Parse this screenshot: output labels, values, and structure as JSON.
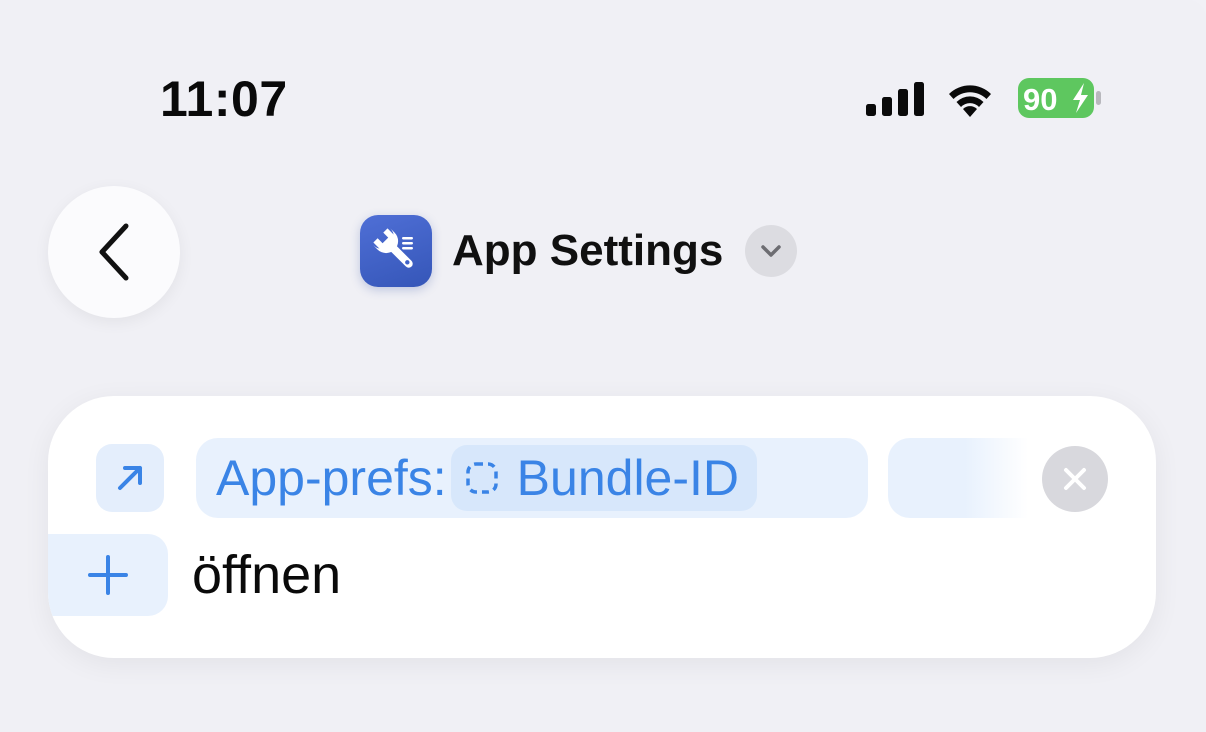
{
  "status_bar": {
    "time": "11:07",
    "battery_level": "90",
    "icons": [
      "cellular-signal-icon",
      "wifi-icon",
      "battery-charging-icon"
    ]
  },
  "header": {
    "back_icon": "chevron-left-icon",
    "app_icon": "wrench-icon",
    "title": "App Settings",
    "menu_icon": "chevron-down-icon"
  },
  "action": {
    "icon": "arrow-up-right-icon",
    "url_prefix": "App-prefs:",
    "variable_icon": "dashed-square-icon",
    "variable_label": "Bundle-ID",
    "clear_icon": "close-icon",
    "add_icon": "plus-icon",
    "verb": "öffnen"
  },
  "colors": {
    "background": "#f0f0f5",
    "accent_blue": "#3a84e6",
    "token_bg": "#e8f1fd",
    "variable_bg": "#d7e7fb",
    "app_icon_blue": "#3f62c8",
    "battery_green": "#5ec75f"
  }
}
